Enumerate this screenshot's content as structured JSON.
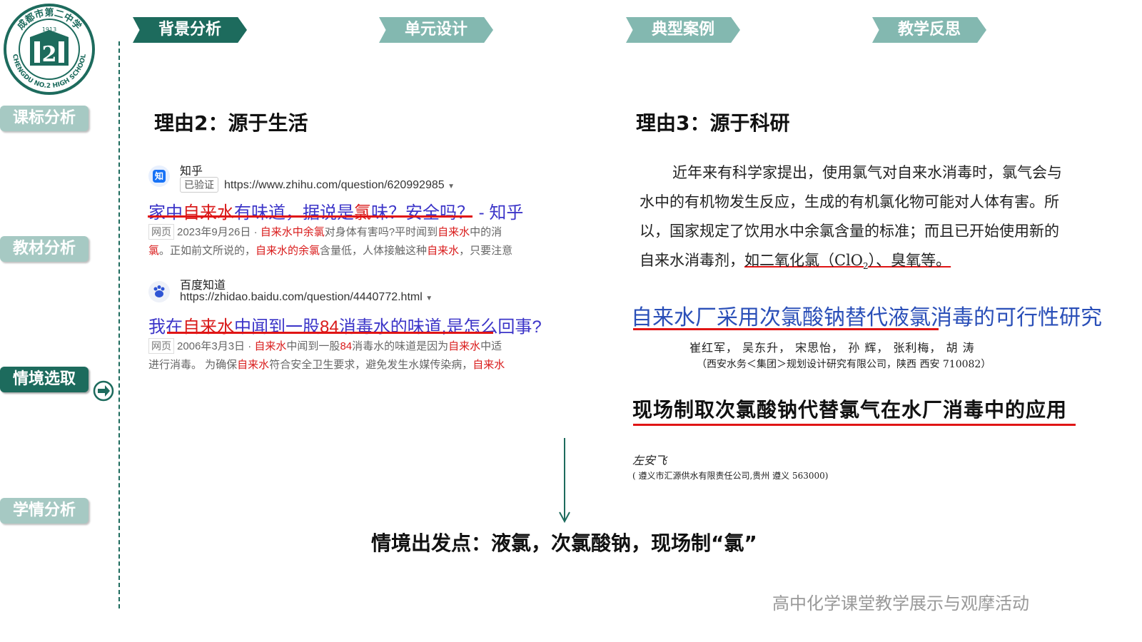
{
  "logo": {
    "school_cn": "成都市第二中学",
    "year": "1913",
    "school_en": "CHENGDU NO.2 HIGH SCHOOL",
    "emblem_number": "2"
  },
  "tabs": [
    {
      "label": "背景分析",
      "active": true
    },
    {
      "label": "单元设计",
      "active": false
    },
    {
      "label": "典型案例",
      "active": false
    },
    {
      "label": "教学反思",
      "active": false
    }
  ],
  "sidebar": [
    {
      "label": "课标分析",
      "active": false
    },
    {
      "label": "教材分析",
      "active": false
    },
    {
      "label": "情境选取",
      "active": true
    },
    {
      "label": "学情分析",
      "active": false
    }
  ],
  "reason2": {
    "title": "理由2：源于生活"
  },
  "reason3": {
    "title": "理由3：源于科研"
  },
  "results": [
    {
      "site": "知乎",
      "icon_text": "知",
      "verified": "已验证",
      "url": "https://www.zhihu.com/question/620992985",
      "title_parts": [
        "家中",
        "自来水",
        "有味道，据说是",
        "氯",
        "味？安全吗？ - 知乎"
      ],
      "tag": "网页",
      "date": "2023年9月26日",
      "snippet1_parts": [
        "自来水中余氯",
        "对身体有害吗?平时闻到",
        "自来水",
        "中的消"
      ],
      "snippet2_parts": [
        "氯",
        "。正如前文所说的，",
        "自来水的余氯",
        "含量低，人体接触这种",
        "自来水",
        "，只要注意"
      ]
    },
    {
      "site": "百度知道",
      "url": "https://zhidao.baidu.com/question/4440772.html",
      "title_parts": [
        "我在",
        "自来水",
        "中闻到一股",
        "84",
        "消毒水的味道,是怎么回事?"
      ],
      "tag": "网页",
      "date": "2006年3月3日",
      "snippet1_parts": [
        "自来水",
        "中闻到一股",
        "84",
        "消毒水的味道是因为",
        "自来水",
        "中适"
      ],
      "snippet2_parts": [
        "进行消毒。 为确保",
        "自来水",
        "符合安全卫生要求，避免发生水媒传染病，",
        "自来水"
      ]
    }
  ],
  "paper": {
    "paragraph": "近年来有科学家提出，使用氯气对自来水消毒时，氯气会与水中的有机物发生反应，生成的有机氯化物可能对人体有害。所以，国家规定了饮用水中余氯含量的标准；而且已开始使用新的自来水消毒剂，",
    "paragraph_underlined": "如二氧化氯（ClO",
    "paragraph_sub": "2",
    "paragraph_tail": "）、臭氧等。",
    "title1": "自来水厂采用次氯酸钠替代液氯消毒的可行性研究",
    "authors1": "崔红军，  吴东升，  宋思怡，  孙   辉，  张利梅，  胡   涛",
    "affil1": "（西安水务＜集团＞规划设计研究有限公司，陕西  西安  710082）",
    "title2": "现场制取次氯酸钠代替氯气在水厂消毒中的应用",
    "author2": "左安飞",
    "affil2": "( 遵义市汇源供水有限责任公司,贵州   遵义    563000)"
  },
  "conclusion": "情境出发点：液氯，次氯酸钠，现场制“氯”",
  "footer": "高中化学课堂教学展示与观摩活动",
  "colors": {
    "accent": "#1d6b5d",
    "accent_light": "#83b8b0",
    "link": "#3b34c8",
    "highlight": "#d91a1a"
  }
}
